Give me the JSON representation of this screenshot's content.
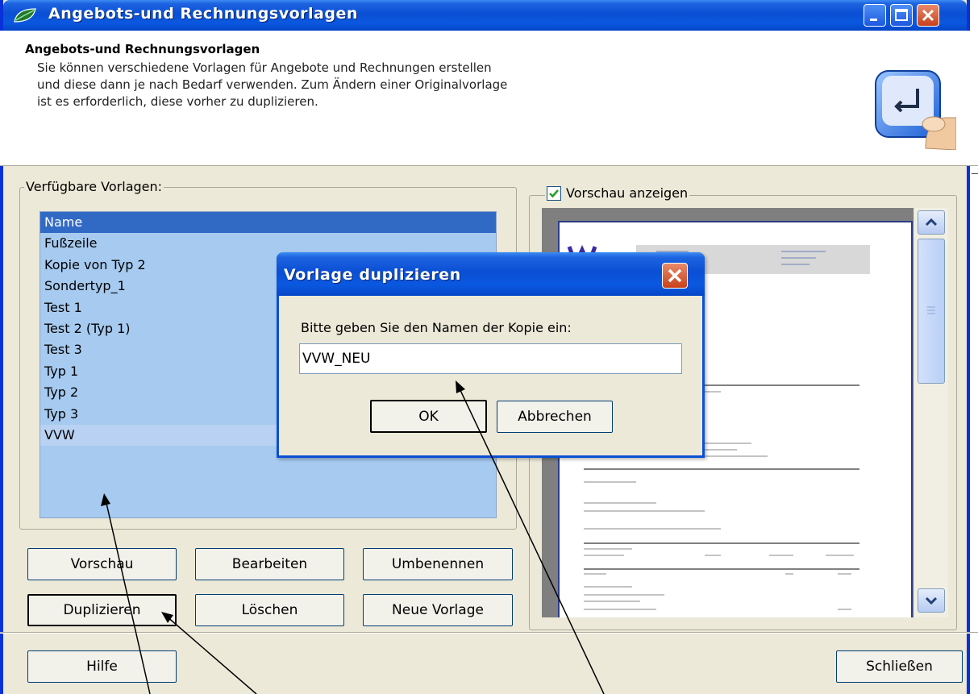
{
  "window": {
    "title": "Angebots-und Rechnungsvorlagen"
  },
  "header": {
    "title": "Angebots-und Rechnungsvorlagen",
    "lines": [
      "Sie können verschiedene Vorlagen für Angebote und Rechnungen erstellen",
      "und diese dann je nach Bedarf verwenden. Zum Ändern einer Originalvorlage",
      "ist es erforderlich, diese vorher zu duplizieren."
    ],
    "icon": "keyboard-enter-key-icon"
  },
  "templates": {
    "group_label": "Verfügbare Vorlagen:",
    "column_header": "Name",
    "items": [
      "Fußzeile",
      "Kopie von Typ 2",
      "Sondertyp_1",
      "Test 1",
      "Test 2 (Typ 1)",
      "Test 3",
      "Typ 1",
      "Typ 2",
      "Typ 3",
      "VVW"
    ],
    "selected": "VVW"
  },
  "buttons": {
    "preview": "Vorschau",
    "edit": "Bearbeiten",
    "rename": "Umbenennen",
    "duplicate": "Duplizieren",
    "delete": "Löschen",
    "new_template": "Neue Vorlage",
    "help": "Hilfe",
    "close": "Schließen"
  },
  "preview": {
    "checkbox_label": "Vorschau anzeigen",
    "checked": true
  },
  "dialog": {
    "title": "Vorlage duplizieren",
    "prompt": "Bitte geben Sie den Namen der Kopie ein:",
    "input_value": "VVW_NEU",
    "ok": "OK",
    "cancel": "Abbrechen"
  },
  "colors": {
    "titlebar": "#0a4fd4",
    "list_background": "#a6caf0",
    "list_header": "#316ac5",
    "dialog_bg": "#ece9d8"
  }
}
